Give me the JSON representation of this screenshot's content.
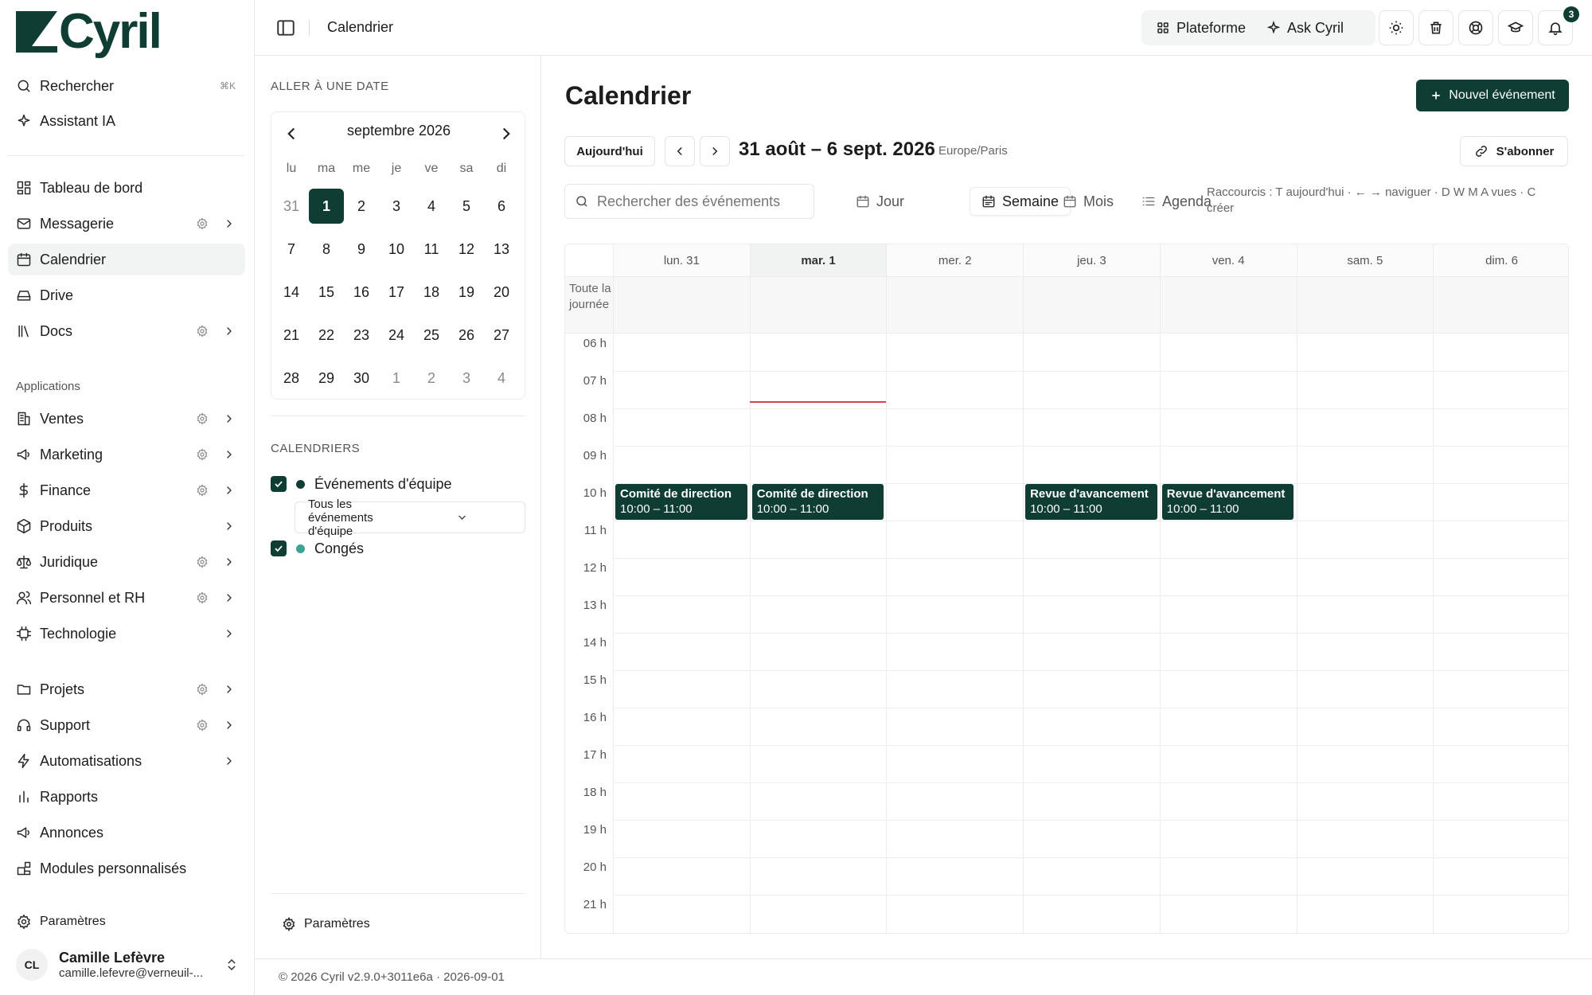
{
  "brand": {
    "name": "Cyril",
    "color": "#0f3d34"
  },
  "sidebar": {
    "top": [
      {
        "label": "Rechercher",
        "icon": "search-icon",
        "shortcut": "⌘K"
      },
      {
        "label": "Assistant IA",
        "icon": "sparkle-icon"
      }
    ],
    "main": [
      {
        "label": "Tableau de bord",
        "icon": "dashboard-icon"
      },
      {
        "label": "Messagerie",
        "icon": "mail-icon",
        "settings": true,
        "chevron": true
      },
      {
        "label": "Calendrier",
        "icon": "calendar-icon",
        "active": true
      },
      {
        "label": "Drive",
        "icon": "drive-icon"
      },
      {
        "label": "Docs",
        "icon": "library-icon",
        "settings": true,
        "chevron": true
      }
    ],
    "apps_label": "Applications",
    "apps": [
      {
        "label": "Ventes",
        "icon": "building-icon",
        "settings": true,
        "chevron": true
      },
      {
        "label": "Marketing",
        "icon": "megaphone-icon",
        "settings": true,
        "chevron": true
      },
      {
        "label": "Finance",
        "icon": "dollar-icon",
        "settings": true,
        "chevron": true
      },
      {
        "label": "Produits",
        "icon": "box-icon",
        "chevron": true
      },
      {
        "label": "Juridique",
        "icon": "scale-icon",
        "settings": true,
        "chevron": true
      },
      {
        "label": "Personnel et RH",
        "icon": "users-icon",
        "settings": true,
        "chevron": true
      },
      {
        "label": "Technologie",
        "icon": "chip-icon",
        "chevron": true
      }
    ],
    "more": [
      {
        "label": "Projets",
        "icon": "folder-icon",
        "settings": true,
        "chevron": true
      },
      {
        "label": "Support",
        "icon": "headset-icon",
        "settings": true,
        "chevron": true
      },
      {
        "label": "Automatisations",
        "icon": "bolt-icon",
        "chevron": true
      },
      {
        "label": "Rapports",
        "icon": "bar-chart-icon"
      },
      {
        "label": "Annonces",
        "icon": "megaphone-icon"
      },
      {
        "label": "Modules personnalisés",
        "icon": "blocks-icon"
      }
    ],
    "settings_label": "Paramètres",
    "user": {
      "initials": "CL",
      "name": "Camille Lefèvre",
      "email": "camille.lefevre@verneuil-..."
    }
  },
  "topbar": {
    "breadcrumb": "Calendrier",
    "platform_label": "Plateforme",
    "ask_label": "Ask Cyril",
    "notifications_count": "3"
  },
  "left_panel": {
    "goto_title": "ALLER À UNE DATE",
    "month_label": "septembre 2026",
    "weekdays": [
      "lu",
      "ma",
      "me",
      "je",
      "ve",
      "sa",
      "di"
    ],
    "weeks": [
      [
        "31",
        "1",
        "2",
        "3",
        "4",
        "5",
        "6"
      ],
      [
        "7",
        "8",
        "9",
        "10",
        "11",
        "12",
        "13"
      ],
      [
        "14",
        "15",
        "16",
        "17",
        "18",
        "19",
        "20"
      ],
      [
        "21",
        "22",
        "23",
        "24",
        "25",
        "26",
        "27"
      ],
      [
        "28",
        "29",
        "30",
        "1",
        "2",
        "3",
        "4"
      ]
    ],
    "selected_day": "1",
    "calendars_title": "CALENDRIERS",
    "calendars": [
      {
        "name": "Événements d'équipe",
        "color": "#0f3d34",
        "checked": true
      },
      {
        "name": "Congés",
        "color": "#3aa394",
        "checked": true
      }
    ],
    "team_filter": "Tous les événements d'équipe",
    "settings_label": "Paramètres"
  },
  "main": {
    "title": "Calendrier",
    "new_event_label": "Nouvel événement",
    "today_label": "Aujourd'hui",
    "range_label": "31 août – 6 sept. 2026",
    "timezone": "Europe/Paris",
    "subscribe_label": "S'abonner",
    "search_placeholder": "Rechercher des événements",
    "views": [
      {
        "label": "Jour",
        "icon": "calendar-day-icon"
      },
      {
        "label": "Semaine",
        "icon": "calendar-week-icon",
        "active": true
      },
      {
        "label": "Mois",
        "icon": "calendar-month-icon"
      },
      {
        "label": "Agenda",
        "icon": "list-icon"
      }
    ],
    "shortcuts": "Raccourcis : T aujourd'hui · ← → naviguer · D W M A vues · C créer",
    "allday_label": "Toute la journée",
    "days": [
      "lun. 31",
      "mar. 1",
      "mer. 2",
      "jeu. 3",
      "ven. 4",
      "sam. 5",
      "dim. 6"
    ],
    "today_index": 1,
    "hours": [
      "06 h",
      "07 h",
      "08 h",
      "09 h",
      "10 h",
      "11 h",
      "12 h",
      "13 h",
      "14 h",
      "15 h",
      "16 h",
      "17 h",
      "18 h",
      "19 h",
      "20 h",
      "21 h"
    ],
    "first_hour": 6,
    "now_time": 7.8,
    "events": [
      {
        "day": 0,
        "title": "Comité de direction",
        "time": "10:00 – 11:00",
        "start": 10,
        "end": 11
      },
      {
        "day": 1,
        "title": "Comité de direction",
        "time": "10:00 – 11:00",
        "start": 10,
        "end": 11
      },
      {
        "day": 3,
        "title": "Revue d'avancement",
        "time": "10:00 – 11:00",
        "start": 10,
        "end": 11
      },
      {
        "day": 4,
        "title": "Revue d'avancement",
        "time": "10:00 – 11:00",
        "start": 10,
        "end": 11
      }
    ]
  },
  "footer": {
    "text": "© 2026 Cyril v2.9.0+3011e6a · 2026-09-01"
  }
}
